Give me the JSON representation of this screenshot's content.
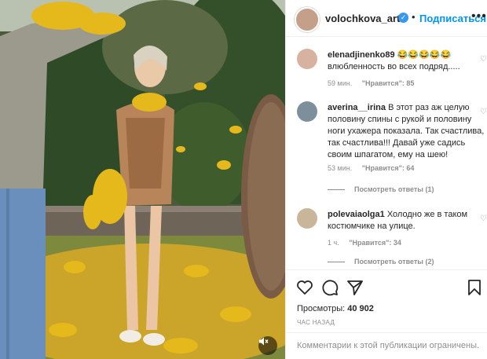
{
  "post": {
    "author": "volochkova_art",
    "separator": "•",
    "follow_label": "Подписаться",
    "more_icon": "more-horizontal-icon",
    "verified_icon": "verified-badge-icon"
  },
  "comments": [
    {
      "user": "elenadjinenko89",
      "text": "😂😂😂😂😂 влюбленность во всех подряд.....",
      "time": "59 мин.",
      "likes": "\"Нравится\": 85",
      "replies": ""
    },
    {
      "user": "averina__irina",
      "text": "В этот раз аж целую половину спины с рукой и половину ноги ухажера показала. Так счастлива, так счастлива!!! Давай уже садись своим шпагатом, ему на шею!",
      "time": "53 мин.",
      "likes": "\"Нравится\": 64",
      "replies": "Посмотреть ответы (1)"
    },
    {
      "user": "polevaiaolga1",
      "text": "Холодно же в таком костюмчике на улице.",
      "time": "1 ч.",
      "likes": "\"Нравится\": 34",
      "replies": "Посмотреть ответы (2)"
    }
  ],
  "actions": {
    "like_icon": "heart-icon",
    "comment_icon": "comment-icon",
    "share_icon": "send-icon",
    "save_icon": "bookmark-icon"
  },
  "stats": {
    "views_label": "Просмотры:",
    "views_value": "40 902",
    "time_ago": "ЧАС НАЗАД"
  },
  "footer": {
    "comments_disabled": "Комментарии к этой публикации ограничены."
  },
  "media": {
    "mute_icon": "speaker-mute-icon"
  },
  "colors": {
    "accent": "#0095f6",
    "verified": "#3897f0",
    "muted_text": "#8e8e8e",
    "leaves": "#e5b81c"
  }
}
